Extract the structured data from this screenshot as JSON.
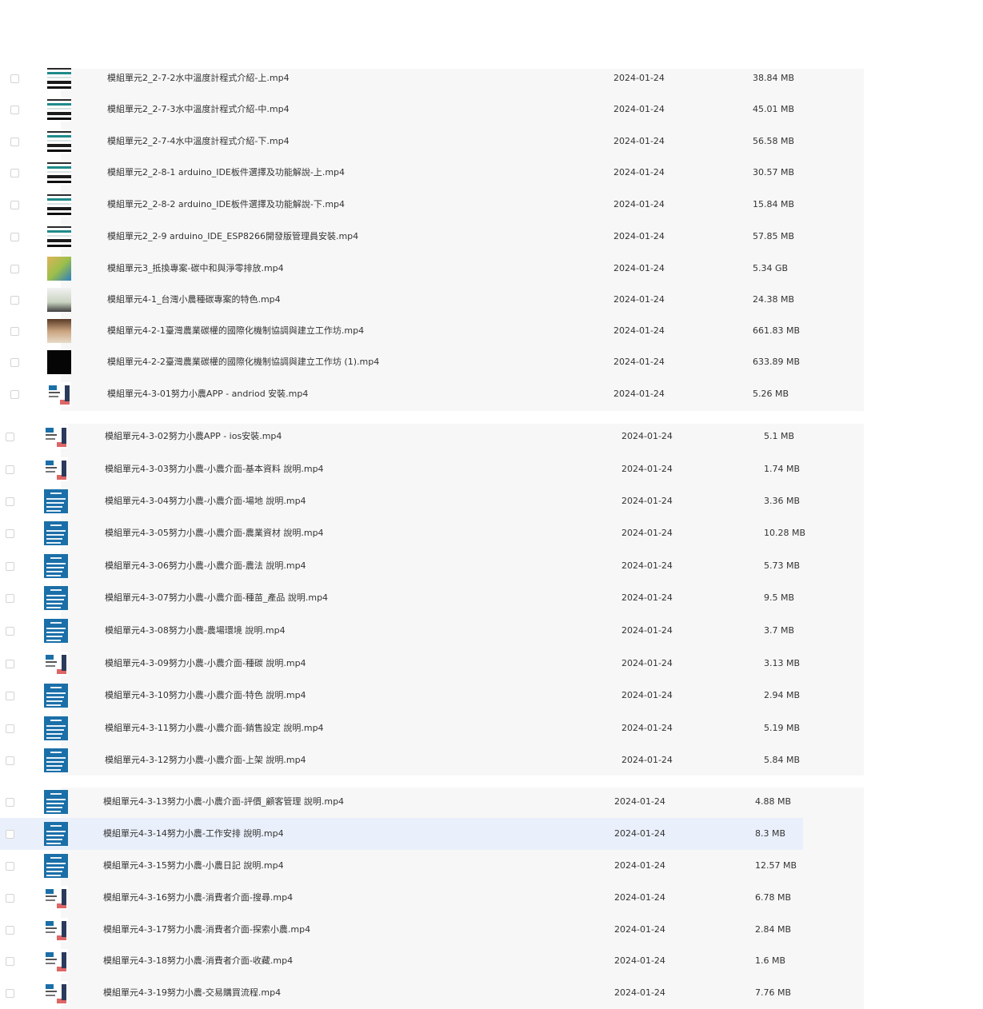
{
  "files": [
    {
      "name": "模組單元2_2-7-2水中溫度計程式介紹-上.mp4",
      "date": "2024-01-24",
      "size": "38.84 MB",
      "thumb": "code"
    },
    {
      "name": "模組單元2_2-7-3水中溫度計程式介紹-中.mp4",
      "date": "2024-01-24",
      "size": "45.01 MB",
      "thumb": "code"
    },
    {
      "name": "模組單元2_2-7-4水中溫度計程式介紹-下.mp4",
      "date": "2024-01-24",
      "size": "56.58 MB",
      "thumb": "code"
    },
    {
      "name": "模組單元2_2-8-1 arduino_IDE板件選擇及功能解說-上.mp4",
      "date": "2024-01-24",
      "size": "30.57 MB",
      "thumb": "code"
    },
    {
      "name": "模組單元2_2-8-2 arduino_IDE板件選擇及功能解說-下.mp4",
      "date": "2024-01-24",
      "size": "15.84 MB",
      "thumb": "code"
    },
    {
      "name": "模組單元2_2-9 arduino_IDE_ESP8266開發版管理員安裝.mp4",
      "date": "2024-01-24",
      "size": "57.85 MB",
      "thumb": "code"
    },
    {
      "name": "模組單元3_抵換專案-碳中和與淨零排放.mp4",
      "date": "2024-01-24",
      "size": "5.34 GB",
      "thumb": "photo1"
    },
    {
      "name": "模組單元4-1_台灣小農種碳專案的特色.mp4",
      "date": "2024-01-24",
      "size": "24.38 MB",
      "thumb": "photo2"
    },
    {
      "name": "模組單元4-2-1臺灣農業碳權的國際化機制協調與建立工作坊.mp4",
      "date": "2024-01-24",
      "size": "661.83 MB",
      "thumb": "photo3"
    },
    {
      "name": "模組單元4-2-2臺灣農業碳權的國際化機制協調與建立工作坊 (1).mp4",
      "date": "2024-01-24",
      "size": "633.89 MB",
      "thumb": "dark"
    },
    {
      "name": "模組單元4-3-01努力小農APP - andriod 安裝.mp4",
      "date": "2024-01-24",
      "size": "5.26 MB",
      "thumb": "app"
    },
    {
      "name": "模組單元4-3-02努力小農APP - ios安裝.mp4",
      "date": "2024-01-24",
      "size": "5.1 MB",
      "thumb": "app"
    },
    {
      "name": "模組單元4-3-03努力小農-小農介面-基本資料 說明.mp4",
      "date": "2024-01-24",
      "size": "1.74 MB",
      "thumb": "app"
    },
    {
      "name": "模組單元4-3-04努力小農-小農介面-場地 說明.mp4",
      "date": "2024-01-24",
      "size": "3.36 MB",
      "thumb": "blue"
    },
    {
      "name": "模組單元4-3-05努力小農-小農介面-農業資材 說明.mp4",
      "date": "2024-01-24",
      "size": "10.28 MB",
      "thumb": "blue"
    },
    {
      "name": "模組單元4-3-06努力小農-小農介面-農法 說明.mp4",
      "date": "2024-01-24",
      "size": "5.73 MB",
      "thumb": "blue"
    },
    {
      "name": "模組單元4-3-07努力小農-小農介面-種苗_產品 說明.mp4",
      "date": "2024-01-24",
      "size": "9.5 MB",
      "thumb": "blue"
    },
    {
      "name": "模組單元4-3-08努力小農-農場環境 說明.mp4",
      "date": "2024-01-24",
      "size": "3.7 MB",
      "thumb": "blue"
    },
    {
      "name": "模組單元4-3-09努力小農-小農介面-種碳 說明.mp4",
      "date": "2024-01-24",
      "size": "3.13 MB",
      "thumb": "app"
    },
    {
      "name": "模組單元4-3-10努力小農-小農介面-特色 說明.mp4",
      "date": "2024-01-24",
      "size": "2.94 MB",
      "thumb": "blue"
    },
    {
      "name": "模組單元4-3-11努力小農-小農介面-銷售設定 說明.mp4",
      "date": "2024-01-24",
      "size": "5.19 MB",
      "thumb": "blue"
    },
    {
      "name": "模組單元4-3-12努力小農-小農介面-上架 說明.mp4",
      "date": "2024-01-24",
      "size": "5.84 MB",
      "thumb": "blue"
    },
    {
      "name": "模組單元4-3-13努力小農-小農介面-評價_顧客管理 說明.mp4",
      "date": "2024-01-24",
      "size": "4.88 MB",
      "thumb": "blue"
    },
    {
      "name": "模組單元4-3-14努力小農-工作安排 說明.mp4",
      "date": "2024-01-24",
      "size": "8.3 MB",
      "thumb": "blue"
    },
    {
      "name": "模組單元4-3-15努力小農-小農日記 說明.mp4",
      "date": "2024-01-24",
      "size": "12.57 MB",
      "thumb": "blue"
    },
    {
      "name": "模組單元4-3-16努力小農-消費者介面-搜尋.mp4",
      "date": "2024-01-24",
      "size": "6.78 MB",
      "thumb": "app"
    },
    {
      "name": "模組單元4-3-17努力小農-消費者介面-探索小農.mp4",
      "date": "2024-01-24",
      "size": "2.84 MB",
      "thumb": "app"
    },
    {
      "name": "模組單元4-3-18努力小農-消費者介面-收藏.mp4",
      "date": "2024-01-24",
      "size": "1.6 MB",
      "thumb": "app"
    },
    {
      "name": "模組單元4-3-19努力小農-交易購買流程.mp4",
      "date": "2024-01-24",
      "size": "7.76 MB",
      "thumb": "app"
    }
  ],
  "highlighted_row": "模組單元4-3-14努力小農-工作安排 說明.mp4"
}
